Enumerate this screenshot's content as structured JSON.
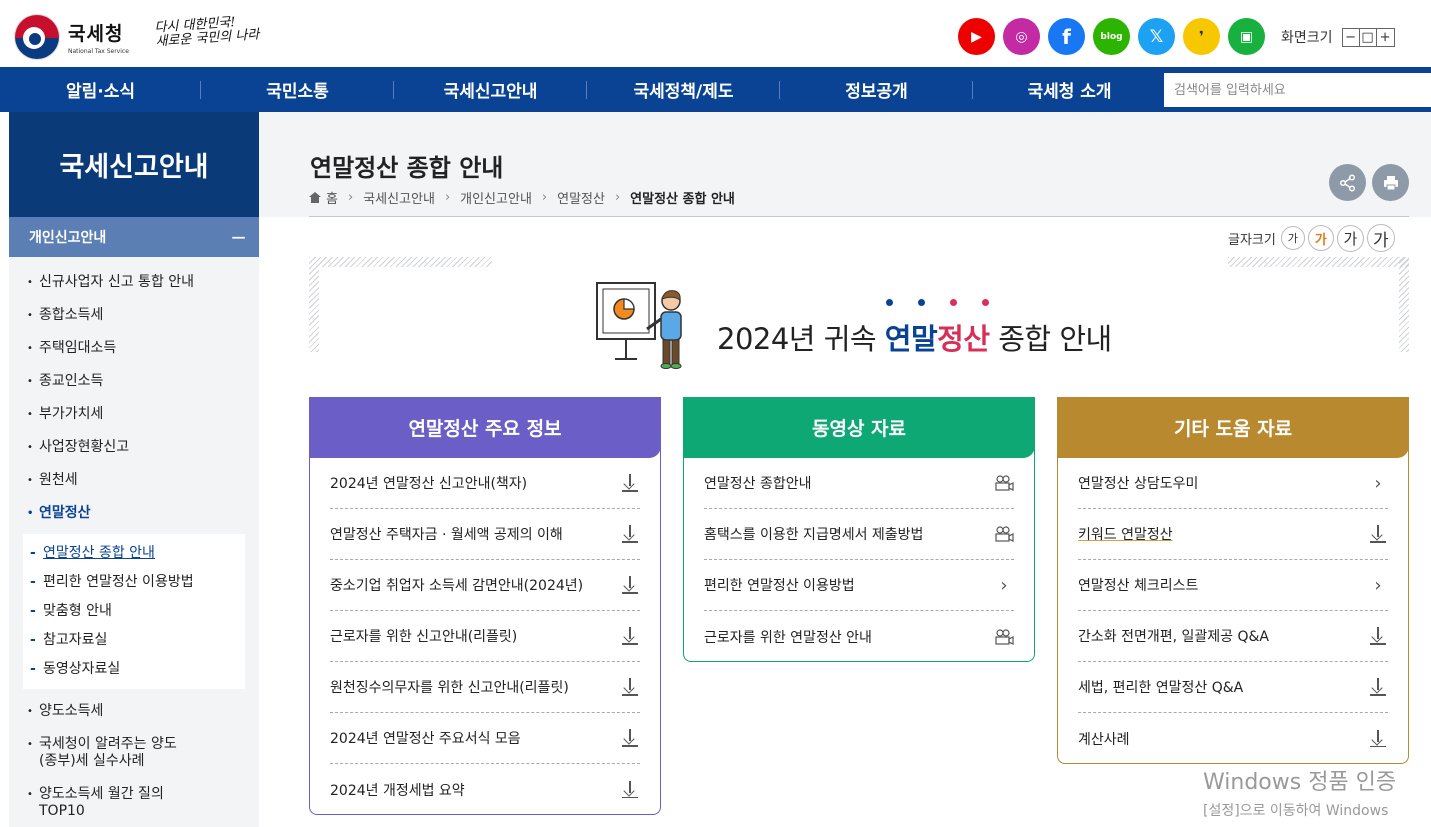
{
  "header": {
    "logo_title": "국세청",
    "logo_sub": "National Tax Service",
    "slogan_line1": "다시 대한민국!",
    "slogan_line2": "새로운 국민의 나라",
    "sns": [
      {
        "name": "youtube-icon",
        "glyph": "▶"
      },
      {
        "name": "instagram-icon",
        "glyph": "◎"
      },
      {
        "name": "facebook-icon",
        "glyph": "f"
      },
      {
        "name": "blog-icon",
        "glyph": "blog"
      },
      {
        "name": "x-icon",
        "glyph": "𝕏"
      },
      {
        "name": "kakao-icon",
        "glyph": "❜"
      },
      {
        "name": "naver-tv-icon",
        "glyph": "▣"
      }
    ],
    "screen_size_label": "화면크기",
    "screen_minus": "−",
    "screen_reset": "□",
    "screen_plus": "+"
  },
  "nav": {
    "items": [
      "알림·소식",
      "국민소통",
      "국세신고안내",
      "국세정책/제도",
      "정보공개",
      "국세청 소개"
    ],
    "search_placeholder": "검색어를 입력하세요"
  },
  "sidebar": {
    "title": "국세신고안내",
    "section": "개인신고안내",
    "section_toggle": "−",
    "items_before": [
      "신규사업자 신고 통합 안내",
      "종합소득세",
      "주택임대소득",
      "종교인소득",
      "부가가치세",
      "사업장현황신고",
      "원천세"
    ],
    "active": "연말정산",
    "sub_items": [
      "연말정산 종합 안내",
      "편리한 연말정산 이용방법",
      "맞춤형 안내",
      "참고자료실",
      "동영상자료실"
    ],
    "items_after": [
      "양도소득세",
      "국세청이 알려주는 양도\n(종부)세 실수사례",
      "양도소득세 월간 질의\nTOP10"
    ]
  },
  "page": {
    "title": "연말정산 종합 안내",
    "breadcrumb": [
      "홈",
      "국세신고안내",
      "개인신고안내",
      "연말정산",
      "연말정산 종합 안내"
    ],
    "font_size_label": "글자크기",
    "font_size_glyph": "가",
    "share_glyph": "⤴",
    "print_glyph": "⎙"
  },
  "banner": {
    "prefix": "2024년 귀속 ",
    "hl1": "연말",
    "hl2": "정산",
    "suffix": " 종합 안내",
    "colors": {
      "blue": "#0a4394",
      "pink": "#d6305a"
    }
  },
  "boxes": {
    "main_info": {
      "title": "연말정산 주요 정보",
      "items": [
        {
          "label": "2024년 연말정산 신고안내(책자)",
          "icon": "download-icon"
        },
        {
          "label": "연말정산 주택자금 · 월세액 공제의 이해",
          "icon": "download-icon"
        },
        {
          "label": "중소기업 취업자 소득세 감면안내(2024년)",
          "icon": "download-icon"
        },
        {
          "label": "근로자를 위한 신고안내(리플릿)",
          "icon": "download-icon"
        },
        {
          "label": "원천징수의무자를 위한 신고안내(리플릿)",
          "icon": "download-icon"
        },
        {
          "label": "2024년 연말정산 주요서식 모음",
          "icon": "download-icon"
        },
        {
          "label": "2024년 개정세법 요약",
          "icon": "download-icon"
        }
      ]
    },
    "video": {
      "title": "동영상 자료",
      "items": [
        {
          "label": "연말정산 종합안내",
          "icon": "video-icon"
        },
        {
          "label": "홈택스를 이용한 지급명세서 제출방법",
          "icon": "video-icon"
        },
        {
          "label": "편리한 연말정산 이용방법",
          "icon": "chevron-right-icon"
        },
        {
          "label": "근로자를 위한 연말정산 안내",
          "icon": "video-icon"
        }
      ]
    },
    "other": {
      "title": "기타 도움 자료",
      "items": [
        {
          "label": "연말정산 상담도우미",
          "icon": "chevron-right-icon"
        },
        {
          "label": "키워드 연말정산",
          "icon": "download-icon"
        },
        {
          "label": "연말정산 체크리스트",
          "icon": "chevron-right-icon"
        },
        {
          "label": "간소화 전면개편, 일괄제공 Q&A",
          "icon": "download-icon"
        },
        {
          "label": "세법, 편리한 연말정산 Q&A",
          "icon": "download-icon"
        },
        {
          "label": "계산사례",
          "icon": "download-icon"
        }
      ]
    }
  },
  "watermark": {
    "line1": "Windows 정품 인증",
    "line2": "[설정]으로 이동하여 Windows"
  }
}
